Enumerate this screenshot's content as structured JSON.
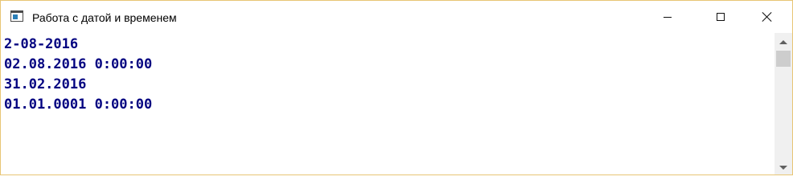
{
  "window": {
    "title": "Работа с датой и временем",
    "icon": "console-window-icon",
    "controls": [
      "minimize-icon",
      "maximize-icon",
      "close-icon"
    ]
  },
  "console": {
    "text_color": "#000080",
    "background": "#ffffff",
    "lines": [
      "2-08-2016",
      "02.08.2016 0:00:00",
      "31.02.2016",
      "01.01.0001 0:00:00"
    ]
  },
  "scrollbar": {
    "icons": [
      "chevron-up-icon",
      "chevron-down-icon"
    ]
  }
}
